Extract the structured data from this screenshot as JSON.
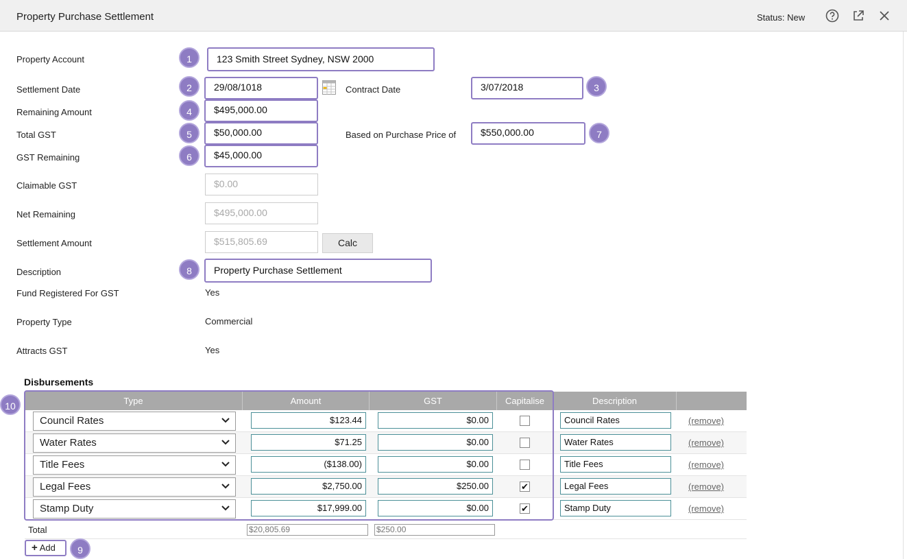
{
  "window": {
    "title": "Property Purchase Settlement",
    "status": "Status: New",
    "icons": [
      "help-icon",
      "open-external-icon",
      "close-icon"
    ]
  },
  "form": {
    "property_account": {
      "label": "Property Account",
      "value": "123 Smith Street Sydney, NSW 2000",
      "badge": "1"
    },
    "settlement_date": {
      "label": "Settlement Date",
      "value": "29/08/1018",
      "badge": "2"
    },
    "contract_date": {
      "label": "Contract Date",
      "value": "3/07/2018",
      "badge": "3"
    },
    "remaining_amount": {
      "label": "Remaining Amount",
      "value": "$495,000.00",
      "badge": "4"
    },
    "total_gst": {
      "label": "Total GST",
      "value": "$50,000.00",
      "badge": "5"
    },
    "based_on_price": {
      "label": "Based on Purchase Price of",
      "value": "$550,000.00",
      "badge": "7"
    },
    "gst_remaining": {
      "label": "GST Remaining",
      "value": "$45,000.00",
      "badge": "6"
    },
    "claimable_gst": {
      "label": "Claimable GST",
      "value": "$0.00"
    },
    "net_remaining": {
      "label": "Net Remaining",
      "value": "$495,000.00"
    },
    "settlement_amount": {
      "label": "Settlement Amount",
      "value": "$515,805.69"
    },
    "calc_label": "Calc",
    "description": {
      "label": "Description",
      "value": "Property Purchase Settlement",
      "badge": "8"
    },
    "fund_registered": {
      "label": "Fund Registered For GST",
      "value": "Yes"
    },
    "property_type": {
      "label": "Property Type",
      "value": "Commercial"
    },
    "attracts_gst": {
      "label": "Attracts GST",
      "value": "Yes"
    }
  },
  "disbursements": {
    "title": "Disbursements",
    "badge": "10",
    "columns": [
      "Type",
      "Amount",
      "GST",
      "Capitalise",
      "Description",
      ""
    ],
    "rows": [
      {
        "type": "Council Rates",
        "amount": "$123.44",
        "gst": "$0.00",
        "capitalise": false,
        "description": "Council Rates",
        "remove": "(remove)"
      },
      {
        "type": "Water Rates",
        "amount": "$71.25",
        "gst": "$0.00",
        "capitalise": false,
        "description": "Water Rates",
        "remove": "(remove)"
      },
      {
        "type": "Title Fees",
        "amount": "($138.00)",
        "gst": "$0.00",
        "capitalise": false,
        "description": "Title Fees",
        "remove": "(remove)"
      },
      {
        "type": "Legal Fees",
        "amount": "$2,750.00",
        "gst": "$250.00",
        "capitalise": true,
        "description": "Legal Fees",
        "remove": "(remove)"
      },
      {
        "type": "Stamp Duty",
        "amount": "$17,999.00",
        "gst": "$0.00",
        "capitalise": true,
        "description": "Stamp Duty",
        "remove": "(remove)"
      }
    ],
    "total": {
      "label": "Total",
      "amount": "$20,805.69",
      "gst": "$250.00"
    },
    "add_label": "Add",
    "add_badge": "9"
  },
  "colors": {
    "highlight": "#8e7cc3",
    "table_header": "#a9a9a9",
    "input_border": "#4a8f97"
  }
}
